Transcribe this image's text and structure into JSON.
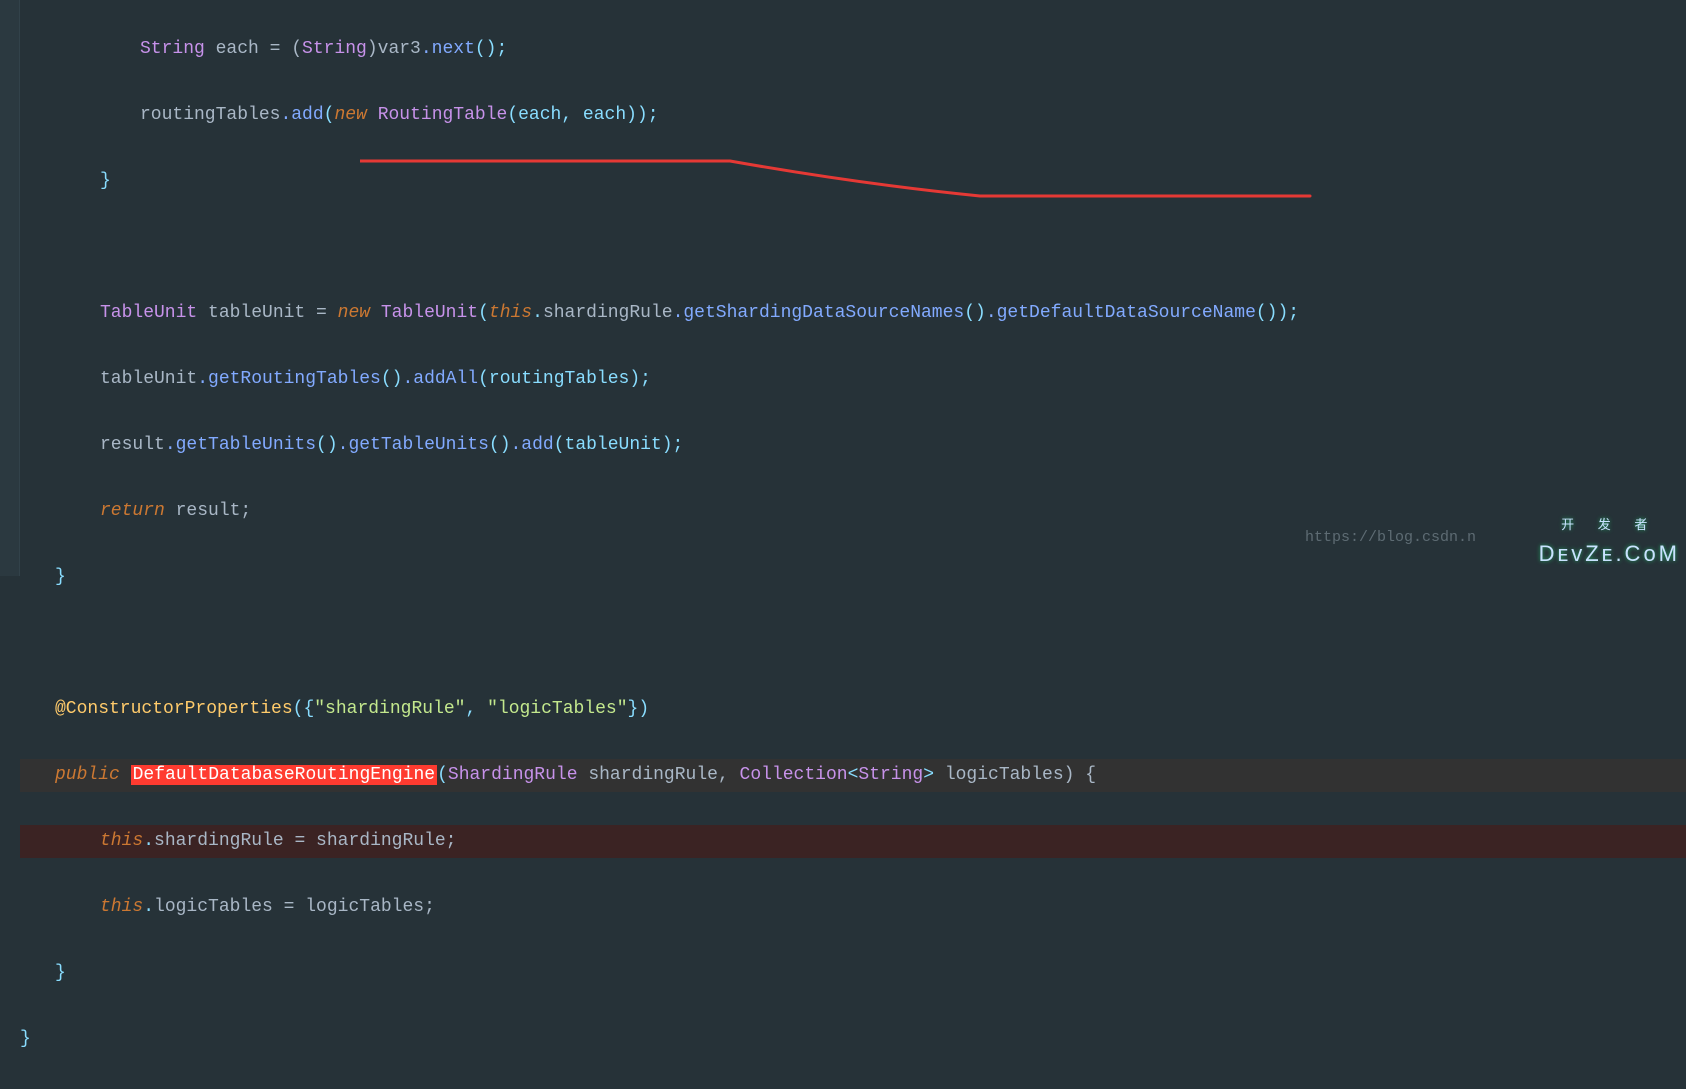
{
  "code": {
    "l1": {
      "ty": "String",
      "id": " each = (",
      "ty2": "String",
      "id2": ")var3",
      "fn": ".next",
      "par": "();"
    },
    "l2": {
      "id": "routingTables",
      "fn": ".add",
      "par": "(",
      "kw": "new ",
      "ty": "RoutingTable",
      "par2": "(each, each));"
    },
    "l3": "}",
    "l4": "",
    "l5": {
      "ty": "TableUnit",
      "id": " tableUnit = ",
      "kw": "new ",
      "ty2": "TableUnit",
      "par": "(",
      "kw2": "this",
      "dot": ".",
      "id2": "shardingRule",
      "fn": ".getShardingDataSourceNames",
      "par2": "()",
      "fn2": ".getDefaultDataSourceName",
      "par3": "());"
    },
    "l6": {
      "id": "tableUnit",
      "fn": ".getRoutingTables",
      "par": "()",
      "fn2": ".addAll",
      "par2": "(routingTables);"
    },
    "l7": {
      "id": "result",
      "fn": ".getTableUnits",
      "par": "()",
      "fn2": ".getTableUnits",
      "par2": "()",
      "fn3": ".add",
      "par3": "(tableUnit);"
    },
    "l8": {
      "kw": "return",
      "id": " result;"
    },
    "l9": "}",
    "l10": "",
    "l11": {
      "ann": "@ConstructorProperties",
      "par": "({",
      "str": "\"shardingRule\"",
      "par2": ", ",
      "str2": "\"logicTables\"",
      "par3": "})"
    },
    "l12": {
      "kw": "public ",
      "hl": "DefaultDatabaseRoutingEngine",
      "par": "(",
      "ty": "ShardingRule",
      "id": " shardingRule, ",
      "ty2": "Collection",
      "par2": "<",
      "ty3": "String",
      "par3": "> ",
      "id2": "logicTables) {"
    },
    "l13": {
      "kw": "this",
      "dot": ".",
      "id": "shardingRule = shardingRule;"
    },
    "l14": {
      "kw": "this",
      "dot": ".",
      "id": "logicTables = logicTables;"
    },
    "l15": "}",
    "l16": "}"
  },
  "watermark": {
    "url": "https://blog.csdn.n",
    "brand_top": "开 发 者",
    "brand_main": "DᴇᴠZᴇ.CᴏM"
  }
}
